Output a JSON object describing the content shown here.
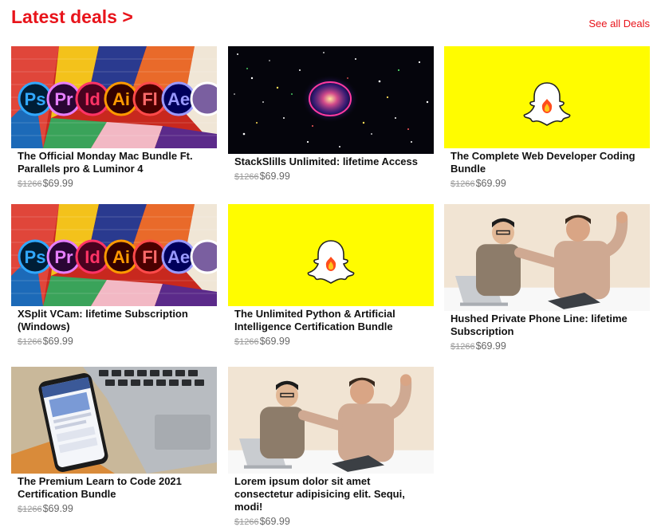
{
  "header": {
    "title": "Latest deals >",
    "see_all": "See all Deals",
    "accent_color": "#e8141b"
  },
  "deals": [
    {
      "title": "The Official Monday Mac Bundle Ft. Parallels pro & Luminor 4",
      "old_price": "$1266",
      "new_price": "$69.99",
      "image": "adobe-apps-icons"
    },
    {
      "title": "StackSlills Unlimited: lifetime Access",
      "old_price": "$1266",
      "new_price": "$69.99",
      "image": "space-nebula"
    },
    {
      "title": "The Complete Web Developer Coding Bundle",
      "old_price": "$1266",
      "new_price": "$69.99",
      "image": "snapchat-logo"
    },
    {
      "title": "XSplit VCam: lifetime Subscription (Windows)",
      "old_price": "$1266",
      "new_price": "$69.99",
      "image": "adobe-apps-icons"
    },
    {
      "title": "The Unlimited Python & Artificial Intelligence Certification Bundle",
      "old_price": "$1266",
      "new_price": "$69.99",
      "image": "snapchat-logo"
    },
    {
      "title": "Hushed Private Phone Line: lifetime Subscription",
      "old_price": "$1266",
      "new_price": "$69.99",
      "image": "two-men-arguing"
    },
    {
      "title": "The Premium Learn to Code 2021 Certification Bundle",
      "old_price": "$1266",
      "new_price": "$69.99",
      "image": "phone-on-laptop"
    },
    {
      "title": "Lorem ipsum dolor sit amet consectetur adipisicing elit. Sequi, modi!",
      "old_price": "$1266",
      "new_price": "$69.99",
      "image": "two-men-arguing"
    }
  ],
  "adobe_icons": [
    "Ps",
    "Pr",
    "Id",
    "Ai",
    "Fl",
    "Ae"
  ]
}
